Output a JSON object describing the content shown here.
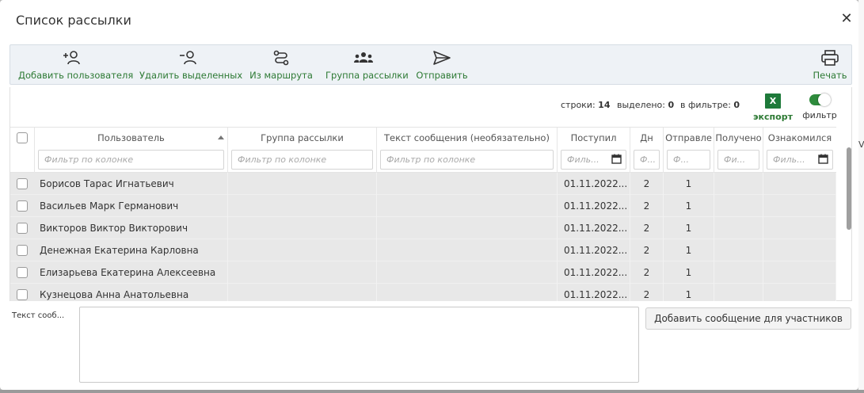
{
  "dialog": {
    "title": "Список рассылки",
    "close_glyph": "✕"
  },
  "toolbar": {
    "add_user": "Добавить пользователя",
    "delete_selected": "Удалить выделенных",
    "from_route": "Из маршрута",
    "mailing_group": "Группа рассылки",
    "send": "Отправить",
    "print": "Печать"
  },
  "stats": {
    "rows_label": "строки:",
    "rows_value": "14",
    "selected_label": "выделено:",
    "selected_value": "0",
    "in_filter_label": "в фильтре:",
    "in_filter_value": "0"
  },
  "export": {
    "icon_letter": "X",
    "label": "экспорт"
  },
  "filter_toggle": {
    "label": "фильтр",
    "on": true
  },
  "columns": [
    {
      "key": "user",
      "label": "Пользователь",
      "filter_placeholder": "Фильтр по колонке"
    },
    {
      "key": "group",
      "label": "Группа рассылки",
      "filter_placeholder": "Фильтр по колонке"
    },
    {
      "key": "text",
      "label": "Текст сообщения (необязательно)",
      "filter_placeholder": "Фильтр по колонке"
    },
    {
      "key": "received",
      "label": "Поступил",
      "filter_placeholder": "Филь..."
    },
    {
      "key": "days",
      "label": "Дн",
      "filter_placeholder": "Ф..."
    },
    {
      "key": "sent",
      "label": "Отправле",
      "filter_placeholder": "Ф..."
    },
    {
      "key": "got",
      "label": "Получено",
      "filter_placeholder": "Фи..."
    },
    {
      "key": "read",
      "label": "Ознакомился",
      "filter_placeholder": "Филь..."
    }
  ],
  "rows": [
    {
      "user": "Борисов Тарас Игнатьевич",
      "group": "",
      "text": "",
      "received": "01.11.2022...",
      "days": "2",
      "sent": "1",
      "got": "",
      "read": ""
    },
    {
      "user": "Васильев Марк Германович",
      "group": "",
      "text": "",
      "received": "01.11.2022...",
      "days": "2",
      "sent": "1",
      "got": "",
      "read": ""
    },
    {
      "user": "Викторов Виктор Викторович",
      "group": "",
      "text": "",
      "received": "01.11.2022...",
      "days": "2",
      "sent": "1",
      "got": "",
      "read": ""
    },
    {
      "user": "Денежная Екатерина Карловна",
      "group": "",
      "text": "",
      "received": "01.11.2022...",
      "days": "2",
      "sent": "1",
      "got": "",
      "read": ""
    },
    {
      "user": "Елизарьева Екатерина Алексеевна",
      "group": "",
      "text": "",
      "received": "01.11.2022...",
      "days": "2",
      "sent": "1",
      "got": "",
      "read": ""
    },
    {
      "user": "Кузнецова Анна Анатольевна",
      "group": "",
      "text": "",
      "received": "01.11.2022...",
      "days": "2",
      "sent": "1",
      "got": "",
      "read": ""
    }
  ],
  "message": {
    "label": "Текст сооб...",
    "value": "",
    "add_button": "Добавить сообщение для участников"
  },
  "edge_letter": "V",
  "colors": {
    "accent_green": "#2d7a34",
    "excel_green": "#1e7a3a",
    "row_bg": "#e8e8e8"
  }
}
